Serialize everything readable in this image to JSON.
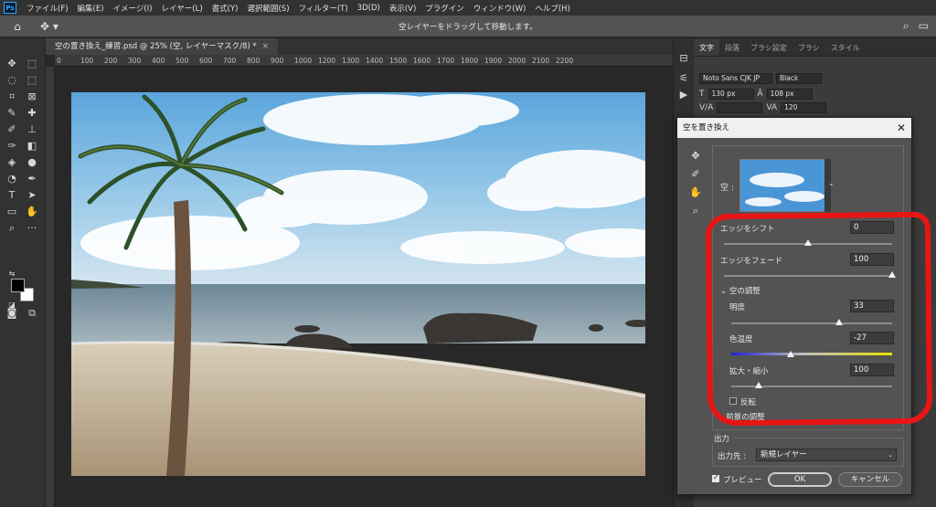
{
  "app": {
    "logo": "Ps",
    "menu": [
      "ファイル(F)",
      "編集(E)",
      "イメージ(I)",
      "レイヤー(L)",
      "書式(Y)",
      "選択範囲(S)",
      "フィルター(T)",
      "3D(D)",
      "表示(V)",
      "プラグイン",
      "ウィンドウ(W)",
      "ヘルプ(H)"
    ]
  },
  "options_bar": {
    "hint": "空レイヤーをドラッグして移動します。"
  },
  "document": {
    "tab_title": "空の置き換え_練習.psd @ 25% (空, レイヤーマスク/8) *",
    "close_glyph": "×"
  },
  "ruler": {
    "ticks": [
      "0",
      "100",
      "200",
      "300",
      "400",
      "500",
      "600",
      "700",
      "800",
      "900",
      "1000",
      "1200",
      "1300",
      "1400",
      "1500",
      "1600",
      "1700",
      "1800",
      "1900",
      "2000",
      "2100",
      "2200"
    ]
  },
  "character_panel": {
    "tabs": [
      "文字",
      "段落",
      "ブラシ設定",
      "ブラシ",
      "スタイル"
    ],
    "font_family": "Noto Sans CJK JP",
    "font_style": "Black",
    "font_size": "130 px",
    "leading": "108 px",
    "tracking": "120"
  },
  "dialog": {
    "title": "空を置き換え",
    "close_glyph": "✕",
    "sky_label": "空 :",
    "edge_shift": {
      "label": "エッジをシフト",
      "value": "0",
      "level": 0.5
    },
    "edge_fade": {
      "label": "エッジをフェード",
      "value": "100",
      "level": 1.0
    },
    "sky_adjust_header": "空の調整",
    "brightness": {
      "label": "明度",
      "value": "33",
      "level": 0.67
    },
    "temperature": {
      "label": "色温度",
      "value": "-27",
      "level": 0.37
    },
    "scale": {
      "label": "拡大・縮小",
      "value": "100",
      "level": 0.17
    },
    "flip_label": "反転",
    "foreground_header": "前景の調整",
    "output_title": "出力",
    "output_to_label": "出力先 :",
    "output_to_value": "新規レイヤー",
    "preview_label": "プレビュー",
    "ok_label": "OK",
    "cancel_label": "キャンセル"
  },
  "colors": {
    "highlight": "#e81515",
    "accent": "#31a8ff"
  }
}
